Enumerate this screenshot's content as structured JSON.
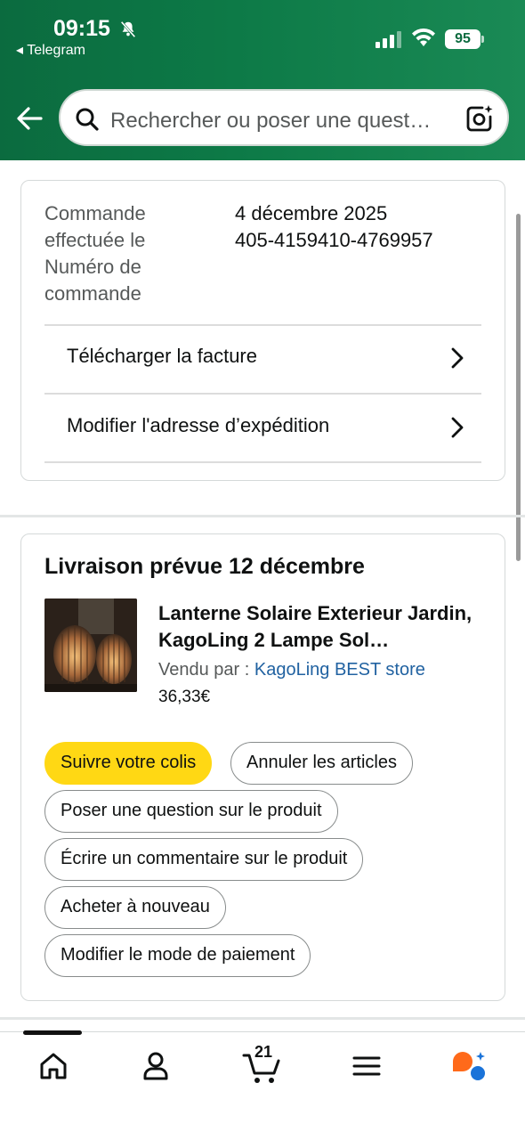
{
  "status_bar": {
    "time": "09:15",
    "back_app": "◂ Telegram",
    "battery": "95"
  },
  "search": {
    "placeholder": "Rechercher ou poser une quest…"
  },
  "order_info": {
    "date_label": "Commande effectuée le",
    "number_label": "Numéro de commande",
    "date_value": "4 décembre 2025",
    "number_value": "405-4159410-4769957"
  },
  "actions": {
    "download_invoice": "Télécharger la facture",
    "edit_address": "Modifier l'adresse d’expédition"
  },
  "delivery": {
    "title": "Livraison prévue 12 décembre",
    "product_title": "Lanterne Solaire Exterieur Jardin, KagoLing 2 Lampe Sol…",
    "sold_by_label": "Vendu par  : ",
    "seller_name": "KagoLing BEST store",
    "price": "36,33€"
  },
  "buttons": {
    "track": "Suivre votre colis",
    "cancel": "Annuler les articles",
    "ask": "Poser une question sur le produit",
    "review": "Écrire un commentaire sur le produit",
    "buy_again": "Acheter à nouveau",
    "payment": "Modifier le mode de paiement"
  },
  "nav": {
    "cart_count": "21"
  },
  "colors": {
    "header_green": "#0b6b3f",
    "primary_button": "#ffd814",
    "link": "#2162a1"
  }
}
